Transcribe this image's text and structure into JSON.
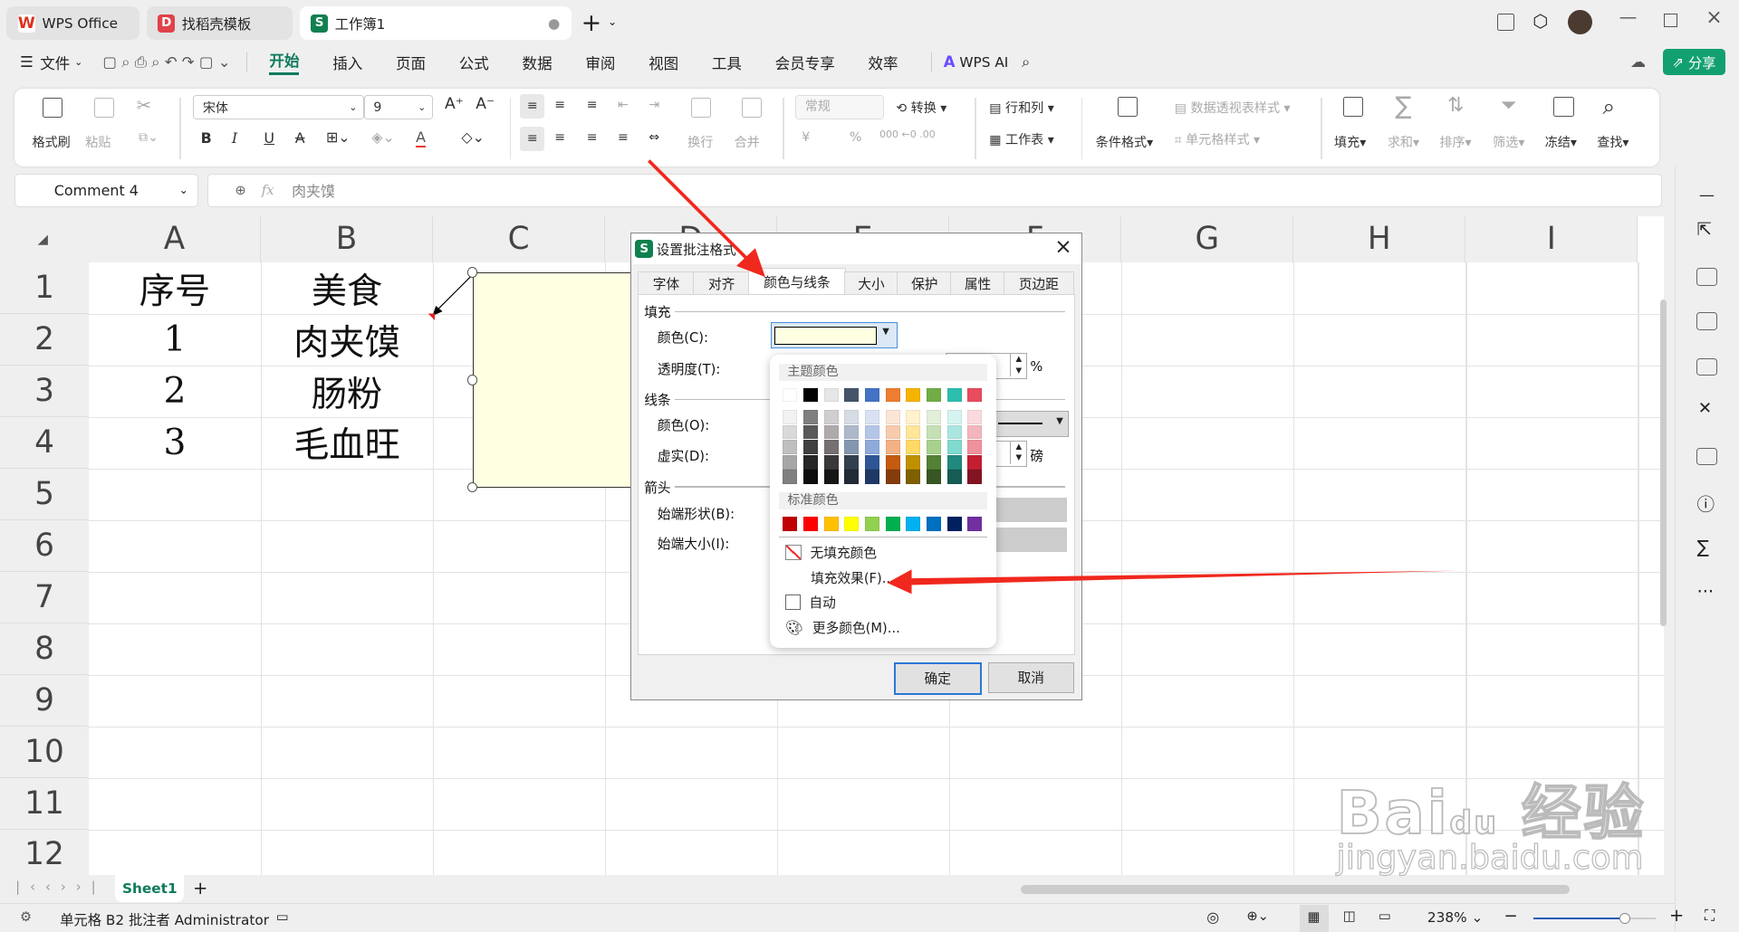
{
  "tabs": [
    {
      "label": "WPS Office",
      "icon": "wps-logo-icon",
      "color": "#e0301e"
    },
    {
      "label": "找稻壳模板",
      "icon": "docer-logo-icon",
      "color": "#e0424a"
    },
    {
      "label": "工作簿1",
      "icon": "spreadsheet-logo-icon",
      "color": "#10804f"
    }
  ],
  "tab_logo_letters": [
    "W",
    "D",
    "S"
  ],
  "new_tab": "+",
  "menu": {
    "file": "文件",
    "items": [
      "开始",
      "插入",
      "页面",
      "公式",
      "数据",
      "审阅",
      "视图",
      "工具",
      "会员专享",
      "效率"
    ],
    "active": "开始",
    "ai": "WPS AI",
    "share": "分享"
  },
  "ribbon": {
    "format_painter": "格式刷",
    "paste": "粘贴",
    "font_name": "宋体",
    "font_size": "9",
    "wrap": "换行",
    "merge": "合并",
    "number_format": "常规",
    "convert": "转换",
    "rows_cols": "行和列",
    "worksheet": "工作表",
    "cond_format": "条件格式",
    "pivot_style": "数据透视表样式",
    "cell_style": "单元格样式",
    "fill": "填充",
    "sum": "求和",
    "sort": "排序",
    "filter": "筛选",
    "freeze": "冻结",
    "find": "查找",
    "bold": "B",
    "italic": "I",
    "underline": "U",
    "strike": "A",
    "currency": "¥",
    "percent": "%"
  },
  "formula_bar": {
    "name_box": "Comment 4",
    "fx": "fx",
    "content": "肉夹馍"
  },
  "columns": [
    "A",
    "B",
    "C",
    "D",
    "E",
    "F",
    "G",
    "H",
    "I"
  ],
  "rows": [
    "1",
    "2",
    "3",
    "4",
    "5",
    "6",
    "7",
    "8",
    "9",
    "10",
    "11",
    "12"
  ],
  "cells": [
    [
      "序号",
      "美食"
    ],
    [
      "1",
      "肉夹馍"
    ],
    [
      "2",
      "肠粉"
    ],
    [
      "3",
      "毛血旺"
    ]
  ],
  "comment_fill": "#ffffe1",
  "dialog": {
    "title": "设置批注格式",
    "close": "×",
    "tabs": [
      "字体",
      "对齐",
      "颜色与线条",
      "大小",
      "保护",
      "属性",
      "页边距"
    ],
    "active_tab": "颜色与线条",
    "fill_section": "填充",
    "fill_color_label": "颜色(C):",
    "transparency_label": "透明度(T):",
    "percent": "%",
    "line_section": "线条",
    "line_color_label": "颜色(O):",
    "dash_label": "虚实(D):",
    "weight_unit": "磅",
    "arrow_section": "箭头",
    "begin_style_label": "始端形状(B):",
    "begin_size_label": "始端大小(I):",
    "ok": "确定",
    "cancel": "取消"
  },
  "color_popup": {
    "theme_header": "主题颜色",
    "theme_colors": [
      "#ffffff",
      "#000000",
      "#e7e6e6",
      "#44546a",
      "#4472c4",
      "#ed7d31",
      "#f4b400",
      "#70ad47",
      "#2dbfae",
      "#e84c5d"
    ],
    "theme_shades": [
      [
        "#f2f2f2",
        "#7f7f7f",
        "#d0cece",
        "#d6dce4",
        "#d9e2f3",
        "#fbe5d6",
        "#fff2cc",
        "#e2efd9",
        "#d5f3f0",
        "#fadadd"
      ],
      [
        "#d9d9d9",
        "#595959",
        "#aeaaaa",
        "#adb9ca",
        "#b4c6e7",
        "#f8cbad",
        "#ffe699",
        "#c5e0b4",
        "#abe6e0",
        "#f4b6bd"
      ],
      [
        "#bfbfbf",
        "#404040",
        "#757171",
        "#8497b0",
        "#8eaadb",
        "#f4b183",
        "#ffd966",
        "#a9d18e",
        "#80dad0",
        "#ef919c"
      ],
      [
        "#a6a6a6",
        "#262626",
        "#3a3838",
        "#323f4f",
        "#2f5597",
        "#c55a11",
        "#bf9000",
        "#538135",
        "#21897e",
        "#c41e33"
      ],
      [
        "#808080",
        "#0d0d0d",
        "#171616",
        "#222a35",
        "#1f3864",
        "#843c0c",
        "#7f6000",
        "#375623",
        "#165c54",
        "#831422"
      ]
    ],
    "standard_header": "标准颜色",
    "standard_colors": [
      "#c00000",
      "#ff0000",
      "#ffc000",
      "#ffff00",
      "#92d050",
      "#00b050",
      "#00b0f0",
      "#0070c0",
      "#002060",
      "#7030a0"
    ],
    "no_fill": "无填充颜色",
    "fill_effects": "填充效果(F)...",
    "automatic": "自动",
    "more_colors": "更多颜色(M)..."
  },
  "sheet_tabs": {
    "sheets": [
      "Sheet1"
    ],
    "active": "Sheet1",
    "add": "+"
  },
  "status_bar": {
    "text": "单元格 B2 批注者 Administrator",
    "zoom": "238%",
    "zoom_level_percent": 238
  },
  "annotation_color": "#f0281e",
  "watermark": {
    "logo": "Bai du 经验",
    "url": "jingyan.baidu.com"
  }
}
